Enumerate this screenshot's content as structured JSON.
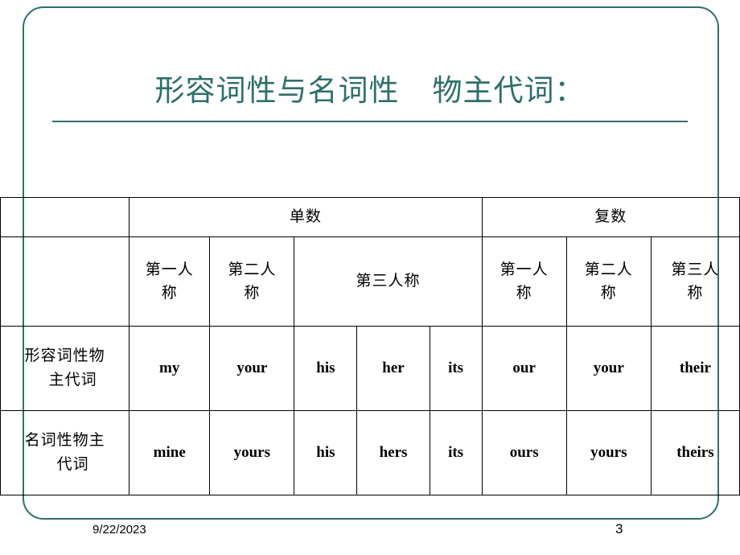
{
  "slide": {
    "title_line": "形容词性与名词性    物主代词：",
    "accent_color": "#2f6f6b",
    "footer": {
      "date": "9/22/2023",
      "page_number": "3"
    }
  },
  "table": {
    "group_headers": {
      "singular": "单数",
      "plural": "复数"
    },
    "person_headers": {
      "singular_first": "第一人\n称",
      "singular_second": "第二人\n称",
      "singular_third": "第三人称",
      "plural_first": "第一人\n称",
      "plural_second": "第二人\n称",
      "plural_third": "第三人\n称"
    },
    "rows": [
      {
        "label": "形容词性物\n主代词",
        "cells": [
          "my",
          "your",
          "his",
          "her",
          "its",
          "our",
          "your",
          "their"
        ]
      },
      {
        "label": "名词性物主\n代词",
        "cells": [
          "mine",
          "yours",
          "his",
          "hers",
          "its",
          "ours",
          "yours",
          "theirs"
        ]
      }
    ]
  }
}
